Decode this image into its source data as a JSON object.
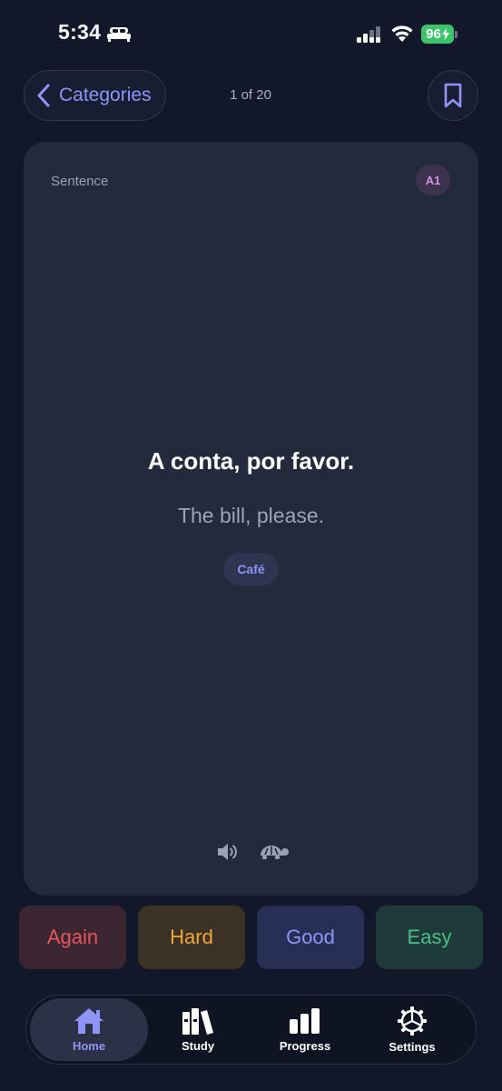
{
  "status_bar": {
    "time": "5:34",
    "battery": "96",
    "icons": [
      "bed-icon",
      "signal-icon",
      "wifi-icon",
      "battery-charging-icon"
    ]
  },
  "nav": {
    "back_label": "Categories",
    "counter": "1 of 20",
    "bookmark_icon": "bookmark-icon"
  },
  "card": {
    "type": "Sentence",
    "level": "A1",
    "phrase": "A conta, por favor.",
    "translation": "The bill, please.",
    "category": "Café",
    "icons": [
      "speaker-icon",
      "turtle-icon"
    ]
  },
  "answers": [
    {
      "label": "Again",
      "color": "#e8565c"
    },
    {
      "label": "Hard",
      "color": "#f0a63a"
    },
    {
      "label": "Good",
      "color": "#8f95f8"
    },
    {
      "label": "Easy",
      "color": "#4bbe8a"
    }
  ],
  "tabs": [
    {
      "label": "Home",
      "icon": "house-icon",
      "active": true
    },
    {
      "label": "Study",
      "icon": "books-icon",
      "active": false
    },
    {
      "label": "Progress",
      "icon": "bar-chart-icon",
      "active": false
    },
    {
      "label": "Settings",
      "icon": "gear-icon",
      "active": false
    }
  ],
  "colors": {
    "background": "#121829",
    "card": "#222a3c",
    "accent": "#8f95f8"
  }
}
